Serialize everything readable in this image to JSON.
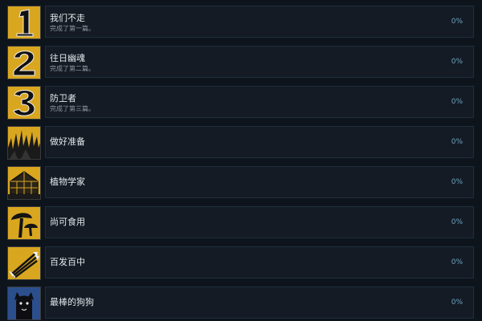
{
  "achievements": [
    {
      "title": "我们不走",
      "desc": "完成了第一篇。",
      "percent": "0%",
      "icon": "number-one-icon"
    },
    {
      "title": "往日幽魂",
      "desc": "完成了第二篇。",
      "percent": "0%",
      "icon": "number-two-icon"
    },
    {
      "title": "防卫者",
      "desc": "完成了第三篇。",
      "percent": "0%",
      "icon": "number-three-icon"
    },
    {
      "title": "做好准备",
      "desc": "",
      "percent": "0%",
      "icon": "spiky-grass-icon"
    },
    {
      "title": "植物学家",
      "desc": "",
      "percent": "0%",
      "icon": "greenhouse-icon"
    },
    {
      "title": "尚可食用",
      "desc": "",
      "percent": "0%",
      "icon": "mushroom-icon"
    },
    {
      "title": "百发百中",
      "desc": "",
      "percent": "0%",
      "icon": "arrows-icon"
    },
    {
      "title": "最棒的狗狗",
      "desc": "",
      "percent": "0%",
      "icon": "dog-icon"
    }
  ],
  "colors": {
    "icon_background": "#d9a620",
    "panel_background": "#141b24",
    "percent_text": "#6fa3c7"
  }
}
